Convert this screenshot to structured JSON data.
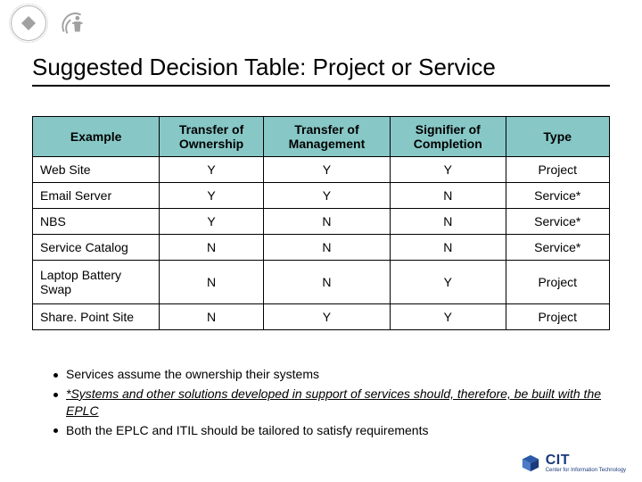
{
  "logos": {
    "left_icon": "diamond-logo-icon",
    "right_icon": "hhs-logo-icon"
  },
  "title": "Suggested Decision Table: Project or Service",
  "table": {
    "headers": {
      "example": "Example",
      "ownership": "Transfer of Ownership",
      "management": "Transfer of Management",
      "signifier": "Signifier of Completion",
      "type": "Type"
    },
    "rows": [
      {
        "example": "Web Site",
        "ownership": "Y",
        "management": "Y",
        "signifier": "Y",
        "type": "Project"
      },
      {
        "example": "Email Server",
        "ownership": "Y",
        "management": "Y",
        "signifier": "N",
        "type": "Service*"
      },
      {
        "example": "NBS",
        "ownership": "Y",
        "management": "N",
        "signifier": "N",
        "type": "Service*"
      },
      {
        "example": "Service Catalog",
        "ownership": "N",
        "management": "N",
        "signifier": "N",
        "type": "Service*"
      },
      {
        "example": "Laptop Battery Swap",
        "ownership": "N",
        "management": "N",
        "signifier": "Y",
        "type": "Project"
      },
      {
        "example": "Share. Point Site",
        "ownership": "N",
        "management": "Y",
        "signifier": "Y",
        "type": "Project"
      }
    ]
  },
  "bullets": {
    "b1": "Services assume the ownership their systems",
    "b2": "*Systems and other solutions developed in support of services should, therefore, be built with the EPLC",
    "b3": "Both the EPLC and ITIL should be tailored to satisfy requirements"
  },
  "cit": {
    "main": "CIT",
    "sub": "Center for Information Technology"
  },
  "chart_data": {
    "type": "table",
    "title": "Suggested Decision Table: Project or Service",
    "columns": [
      "Example",
      "Transfer of Ownership",
      "Transfer of Management",
      "Signifier of Completion",
      "Type"
    ],
    "rows": [
      [
        "Web Site",
        "Y",
        "Y",
        "Y",
        "Project"
      ],
      [
        "Email Server",
        "Y",
        "Y",
        "N",
        "Service*"
      ],
      [
        "NBS",
        "Y",
        "N",
        "N",
        "Service*"
      ],
      [
        "Service Catalog",
        "N",
        "N",
        "N",
        "Service*"
      ],
      [
        "Laptop Battery Swap",
        "N",
        "N",
        "Y",
        "Project"
      ],
      [
        "Share. Point Site",
        "N",
        "Y",
        "Y",
        "Project"
      ]
    ]
  }
}
